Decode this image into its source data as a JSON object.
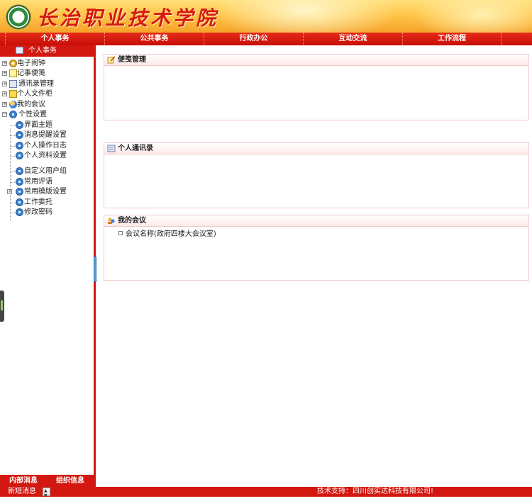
{
  "header": {
    "school_name": "长治职业技术学院"
  },
  "topnav": [
    "个人事务",
    "公共事务",
    "行政办公",
    "互动交流",
    "工作流程"
  ],
  "sidebar": {
    "title": "个人事务",
    "tree": [
      {
        "label": "电子闹钟",
        "icon": "alarm-clock-icon"
      },
      {
        "label": "记事便笺",
        "icon": "sticky-note-icon"
      },
      {
        "label": "通讯录管理",
        "icon": "address-book-icon"
      },
      {
        "label": "个人文件柜",
        "icon": "file-cabinet-icon"
      },
      {
        "label": "我的会议",
        "icon": "meeting-icon"
      },
      {
        "label": "个性设置",
        "icon": "gear-icon",
        "children": [
          "界面主题",
          "消息提醒设置",
          "个人操作日志",
          "个人资料设置",
          "自定义用户组",
          "常用评语",
          "常用模版设置",
          "工作委托",
          "修改密码"
        ]
      }
    ],
    "bottom_tabs": [
      "内部消息",
      "组织信息"
    ]
  },
  "panels": {
    "memo": {
      "title": "便笺管理"
    },
    "contacts": {
      "title": "个人通讯录"
    },
    "meetings": {
      "title": "我的会议",
      "items": [
        "会议名称(政府四楼大会议室)"
      ]
    }
  },
  "statusbar": {
    "new_message": "新短消息",
    "support": "技术支持：四川创实达科技有限公司!"
  }
}
